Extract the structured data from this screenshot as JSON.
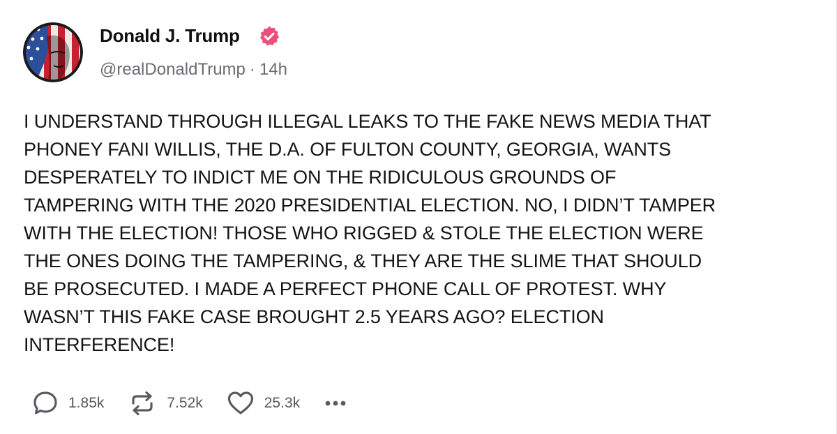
{
  "author": {
    "name": "Donald J. Trump",
    "handle": "@realDonaldTrump",
    "separator": "·",
    "time": "14h",
    "verified_icon": "verified-badge-icon",
    "verified_color": "#ed4f7c"
  },
  "post": {
    "text": "I UNDERSTAND THROUGH ILLEGAL LEAKS TO THE FAKE NEWS MEDIA THAT\nPHONEY FANI WILLIS, THE D.A. OF FULTON COUNTY, GEORGIA, WANTS\nDESPERATELY TO INDICT ME ON THE RIDICULOUS GROUNDS OF\nTAMPERING WITH THE 2020 PRESIDENTIAL ELECTION. NO, I DIDN’T TAMPER\nWITH THE ELECTION! THOSE WHO RIGGED & STOLE THE ELECTION WERE\nTHE ONES DOING THE TAMPERING, & THEY ARE THE SLIME THAT SHOULD\nBE PROSECUTED. I MADE A PERFECT PHONE CALL OF PROTEST. WHY\nWASN’T THIS FAKE CASE BROUGHT 2.5 YEARS AGO? ELECTION\nINTERFERENCE!"
  },
  "actions": {
    "replies": "1.85k",
    "retruths": "7.52k",
    "likes": "25.3k",
    "reply_icon": "reply-bubble-icon",
    "retruth_icon": "retruth-arrows-icon",
    "like_icon": "heart-icon",
    "more_icon": "more-dots-icon"
  },
  "colors": {
    "text": "#141414",
    "muted": "#6b6b72",
    "icon": "#5a5a62"
  }
}
